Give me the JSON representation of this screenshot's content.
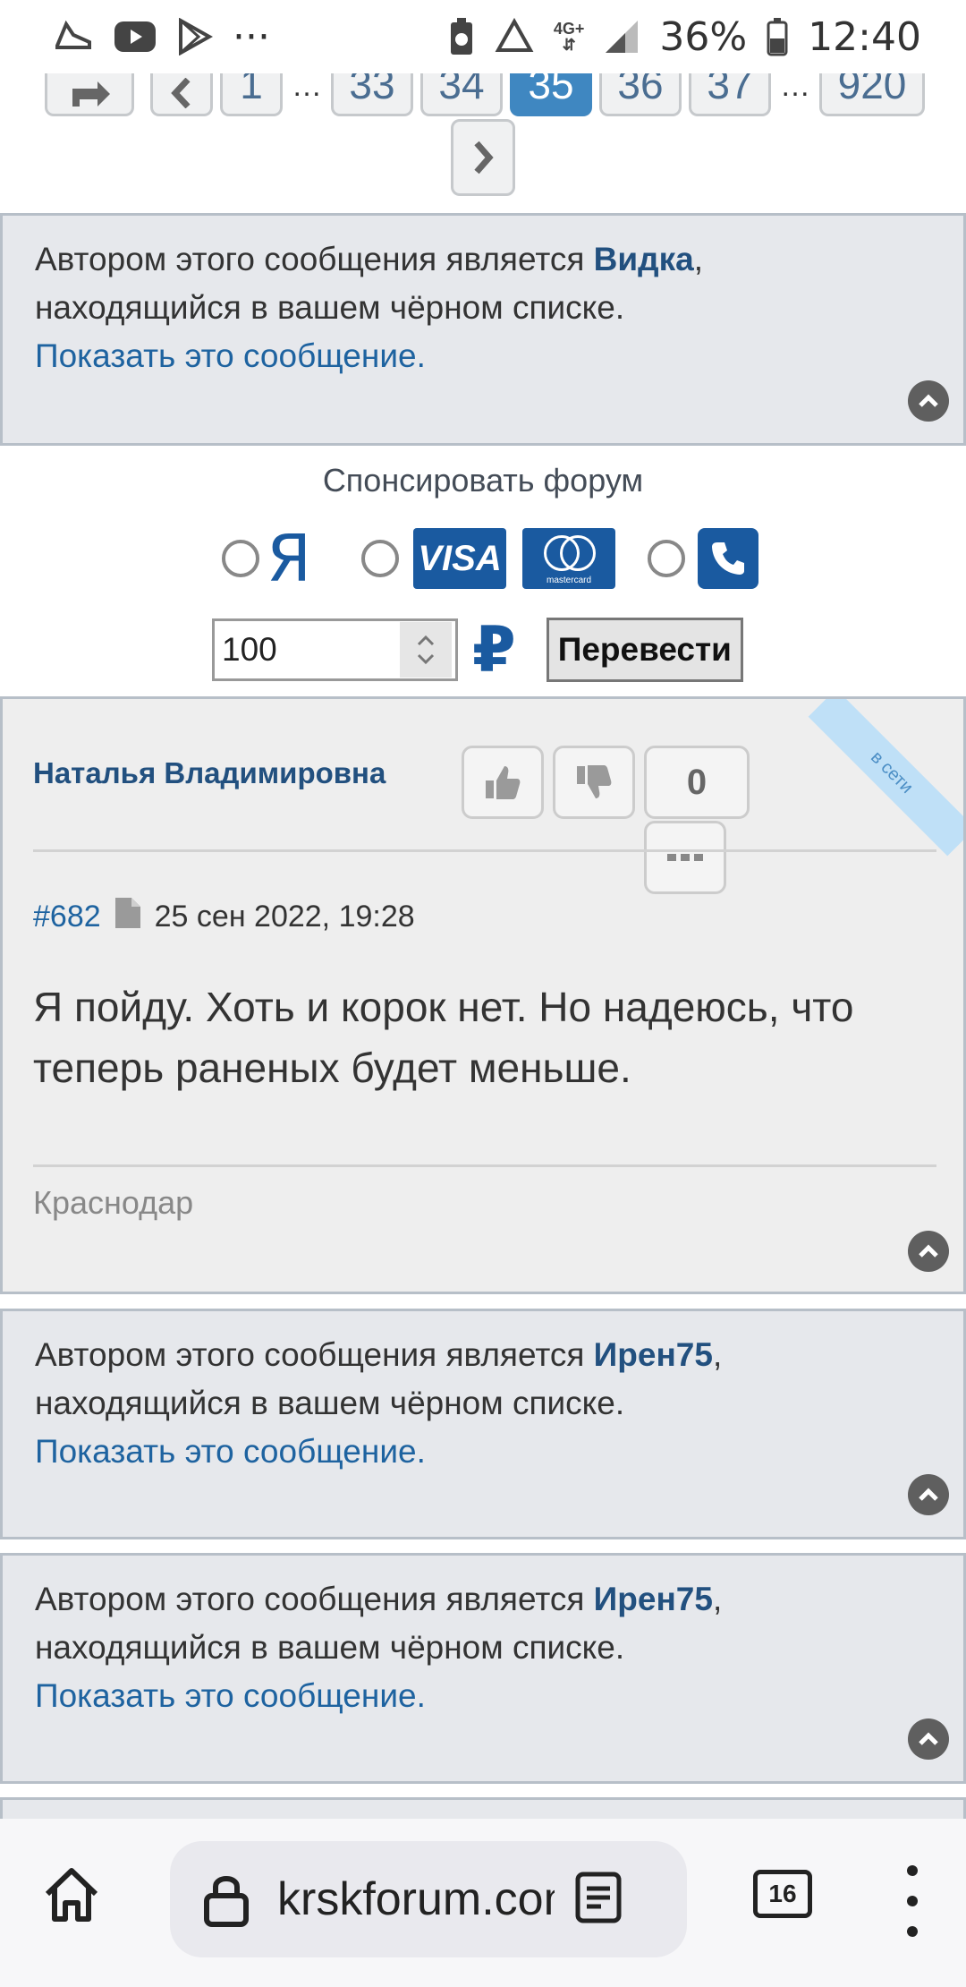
{
  "status_bar": {
    "battery": "36%",
    "time": "12:40",
    "network": "4G+",
    "more": "···"
  },
  "pagination": {
    "pages": [
      "1",
      "33",
      "34",
      "35",
      "36",
      "37",
      "920"
    ],
    "current": "35",
    "ellipsis": "…"
  },
  "blocked_notices": [
    {
      "prefix": "Автором этого сообщения является ",
      "author": "Видка",
      "suffix": ",",
      "line2": "находящийся в вашем чёрном списке.",
      "show": "Показать это сообщение."
    },
    {
      "prefix": "Автором этого сообщения является ",
      "author": "Ирен75",
      "suffix": ",",
      "line2": "находящийся в вашем чёрном списке.",
      "show": "Показать это сообщение."
    },
    {
      "prefix": "Автором этого сообщения является ",
      "author": "Ирен75",
      "suffix": ",",
      "line2": "находящийся в вашем чёрном списке.",
      "show": "Показать это сообщение."
    }
  ],
  "sponsor": {
    "title": "Спонсировать форум",
    "yandex_glyph": "Я",
    "visa_label": "VISA",
    "mastercard_label": "mastercard",
    "amount": "100",
    "currency_glyph": "₽",
    "transfer_button": "Перевести"
  },
  "post": {
    "author": "Наталья Владимировна",
    "online_badge": "в сети",
    "vote_count": "0",
    "number": "#682",
    "date": "25 сен 2022, 19:28",
    "text": "Я пойду. Хоть и корок нет. Но надеюсь, что теперь раненых будет меньше.",
    "location": "Краснодар"
  },
  "browser": {
    "url": "krskforum.com",
    "tab_count": "16"
  },
  "colors": {
    "accent": "#3f87c1",
    "link": "#1e63a0",
    "author": "#22507f",
    "notice_bg": "#e6e8ec",
    "post_bg": "#eeeeee"
  }
}
